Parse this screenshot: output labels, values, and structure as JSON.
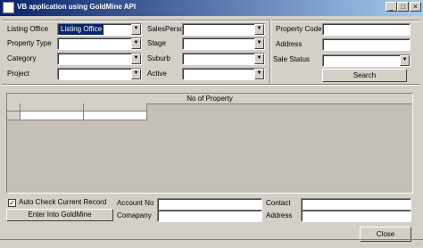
{
  "window": {
    "title": "VB application using GoldMine API",
    "minimize_glyph": "_",
    "maximize_glyph": "□",
    "close_glyph": "×"
  },
  "filters": {
    "listing_office": {
      "label": "Listing Office",
      "value": "Listing Office"
    },
    "property_type": {
      "label": "Property Type",
      "value": ""
    },
    "category": {
      "label": "Category",
      "value": ""
    },
    "project": {
      "label": "Project",
      "value": ""
    },
    "sales_person": {
      "label": "SalesPerson",
      "value": ""
    },
    "stage": {
      "label": "Stage",
      "value": ""
    },
    "suburb": {
      "label": "Suburb",
      "value": ""
    },
    "active": {
      "label": "Active",
      "value": ""
    },
    "property_code": {
      "label": "Property Code",
      "value": ""
    },
    "address": {
      "label": "Address",
      "value": ""
    },
    "sale_status": {
      "label": "Sale Status",
      "value": ""
    },
    "search_button": "Search"
  },
  "grid": {
    "caption": "No of Property"
  },
  "bottom": {
    "auto_check_label": "Auto Check Current Record",
    "auto_check_checked": true,
    "check_glyph": "✓",
    "enter_button": "Enter Into GoldMine",
    "account_no": {
      "label": "Account No",
      "value": ""
    },
    "company": {
      "label": "Comapany",
      "value": ""
    },
    "contact": {
      "label": "Contact",
      "value": ""
    },
    "address": {
      "label": "Address",
      "value": ""
    },
    "close_button": "Close"
  },
  "icons": {
    "dropdown": "▼",
    "size_grip": "⋰"
  },
  "colors": {
    "titlebar_start": "#0a246a",
    "titlebar_end": "#a6caf0",
    "face": "#d4d0c8",
    "selection": "#0a246a"
  }
}
